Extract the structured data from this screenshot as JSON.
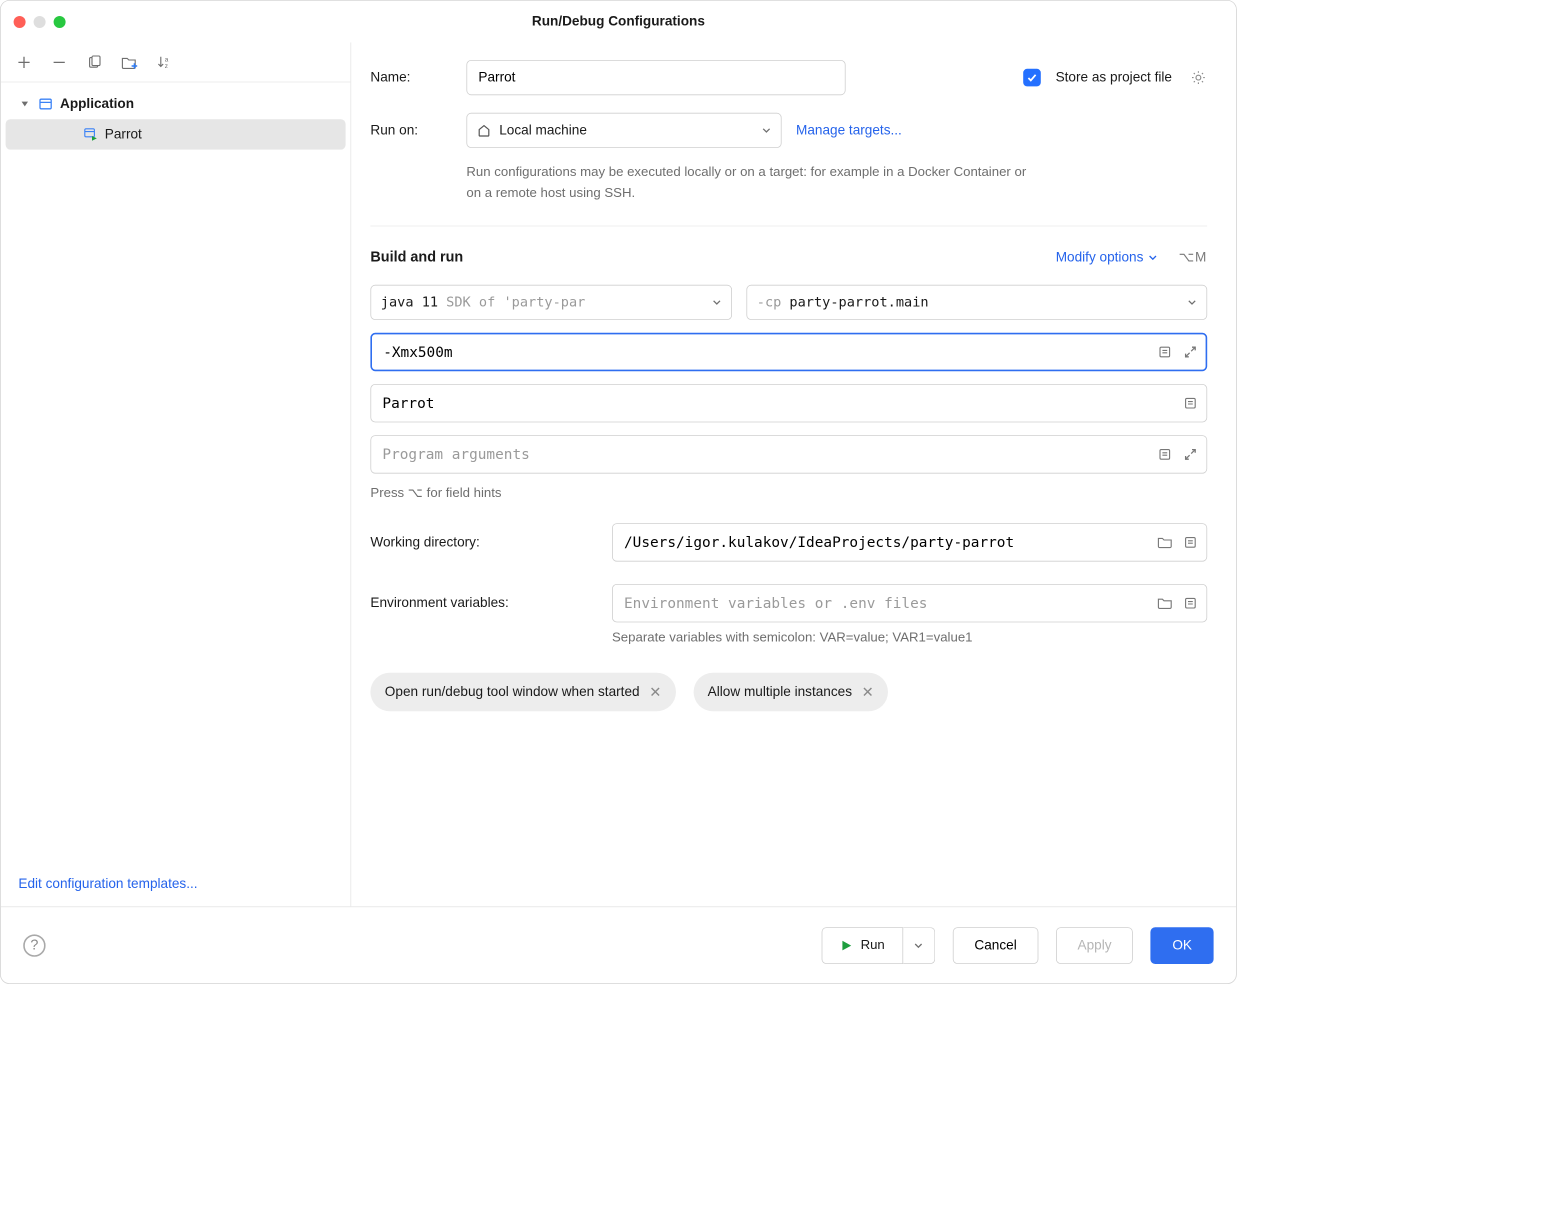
{
  "window_title": "Run/Debug Configurations",
  "sidebar": {
    "group_label": "Application",
    "child_label": "Parrot",
    "edit_templates": "Edit configuration templates..."
  },
  "name": {
    "label": "Name:",
    "value": "Parrot"
  },
  "store_as_project": {
    "checked": true,
    "label": "Store as project file"
  },
  "run_on": {
    "label": "Run on:",
    "value": "Local machine",
    "manage": "Manage targets...",
    "hint": "Run configurations may be executed locally or on a target: for example in a Docker Container or on a remote host using SSH."
  },
  "build_run": {
    "title": "Build and run",
    "modify_options": "Modify options",
    "shortcut": "⌥M",
    "sdk_value": "java 11",
    "sdk_suffix": "SDK of 'party-par",
    "cp_prefix": "-cp",
    "cp_value": "party-parrot.main",
    "vm_options": "-Xmx500m",
    "main_class": "Parrot",
    "program_args_placeholder": "Program arguments",
    "field_hint": "Press ⌥ for field hints"
  },
  "working_dir": {
    "label": "Working directory:",
    "value": "/Users/igor.kulakov/IdeaProjects/party-parrot"
  },
  "env_vars": {
    "label": "Environment variables:",
    "placeholder": "Environment variables or .env files",
    "hint": "Separate variables with semicolon: VAR=value; VAR1=value1"
  },
  "chips": {
    "open_tool": "Open run/debug tool window when started",
    "allow_multiple": "Allow multiple instances"
  },
  "footer": {
    "run": "Run",
    "cancel": "Cancel",
    "apply": "Apply",
    "ok": "OK"
  }
}
